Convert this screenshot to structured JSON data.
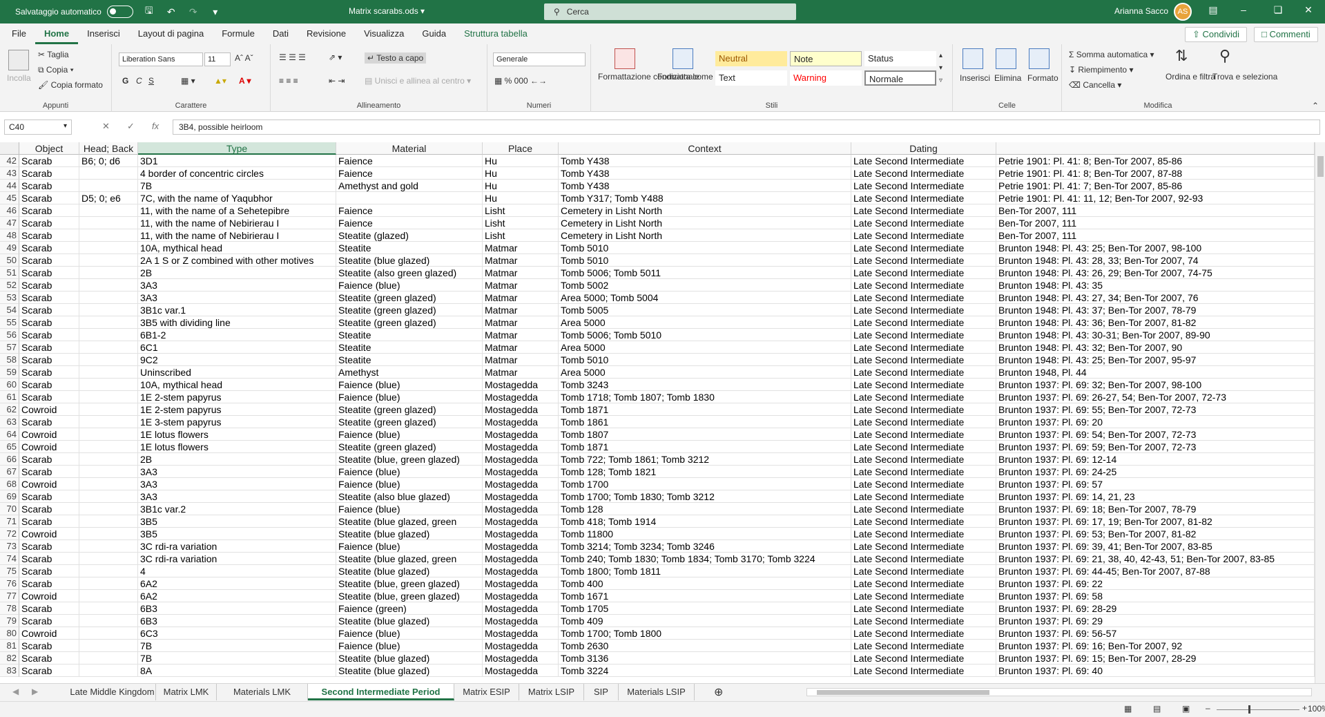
{
  "title_bar": {
    "autosave_label": "Salvataggio automatico",
    "file_name": "Matrix scarabs.ods",
    "search_placeholder": "Cerca",
    "user_name": "Arianna Sacco"
  },
  "menu": {
    "items": [
      "File",
      "Home",
      "Inserisci",
      "Layout di pagina",
      "Formule",
      "Dati",
      "Revisione",
      "Visualizza",
      "Guida",
      "Struttura tabella"
    ],
    "active": "Home",
    "share_label": "Condividi",
    "comments_label": "Commenti"
  },
  "ribbon": {
    "clipboard": {
      "label": "Appunti",
      "paste": "Incolla",
      "cut": "Taglia",
      "copy": "Copia",
      "format_painter": "Copia formato"
    },
    "font": {
      "label": "Carattere",
      "family": "Liberation Sans",
      "size": "11",
      "bold": "G",
      "italic": "C",
      "underline": "S"
    },
    "alignment": {
      "label": "Allineamento",
      "wrap_text": "Testo a capo",
      "merge_center": "Unisci e allinea al centro"
    },
    "number": {
      "label": "Numeri",
      "format": "Generale"
    },
    "styles": {
      "label": "Stili",
      "cond_format": "Formattazione condizionale",
      "format_table": "Formatta come tabella",
      "neutral": "Neutral",
      "note": "Note",
      "status": "Status",
      "text": "Text",
      "warning": "Warning",
      "normal": "Normale"
    },
    "cells": {
      "label": "Celle",
      "insert": "Inserisci",
      "delete": "Elimina",
      "format": "Formato"
    },
    "editing": {
      "label": "Modifica",
      "autosum": "Somma automatica",
      "fill": "Riempimento",
      "clear": "Cancella",
      "sort_filter": "Ordina e filtra",
      "find_select": "Trova e seleziona"
    }
  },
  "formula_bar": {
    "name_box": "C40",
    "formula": "3B4, possible heirloom"
  },
  "columns": [
    "Object",
    "Head; Back",
    "Type",
    "Material",
    "Place",
    "Context",
    "Dating"
  ],
  "rows": [
    [
      "42",
      "Scarab",
      "B6; 0; d6",
      "3D1",
      "Faience",
      "Hu",
      "Tomb Y438",
      "Late Second Intermediate",
      "Petrie 1901: Pl. 41: 8; Ben-Tor 2007, 85-86"
    ],
    [
      "43",
      "Scarab",
      "",
      "4 border of concentric circles",
      "Faience",
      "Hu",
      "Tomb Y438",
      "Late Second Intermediate",
      "Petrie 1901: Pl. 41: 8; Ben-Tor 2007, 87-88"
    ],
    [
      "44",
      "Scarab",
      "",
      "7B",
      "Amethyst and gold",
      "Hu",
      "Tomb Y438",
      "Late Second Intermediate",
      "Petrie 1901: Pl. 41: 7; Ben-Tor 2007, 85-86"
    ],
    [
      "45",
      "Scarab",
      "D5; 0; e6",
      "7C, with the name of Yaqubhor",
      "",
      "Hu",
      "Tomb Y317; Tomb Y488",
      "Late Second Intermediate",
      "Petrie 1901: Pl. 41: 11, 12; Ben-Tor 2007, 92-93"
    ],
    [
      "46",
      "Scarab",
      "",
      "11, with the name of a Sehetepibre",
      "Faience",
      "Lisht",
      "Cemetery in Lisht North",
      "Late Second Intermediate",
      "Ben-Tor 2007, 111"
    ],
    [
      "47",
      "Scarab",
      "",
      "11, with the name of Nebirierau I",
      "Faience",
      "Lisht",
      "Cemetery in Lisht North",
      "Late Second Intermediate",
      "Ben-Tor 2007, 111"
    ],
    [
      "48",
      "Scarab",
      "",
      "11, with the name of Nebirierau I",
      "Steatite (glazed)",
      "Lisht",
      "Cemetery in Lisht North",
      "Late Second Intermediate",
      "Ben-Tor 2007, 111"
    ],
    [
      "49",
      "Scarab",
      "",
      "10A, mythical head",
      "Steatite",
      "Matmar",
      "Tomb 5010",
      "Late Second Intermediate",
      "Brunton 1948: Pl. 43: 25; Ben-Tor 2007, 98-100"
    ],
    [
      "50",
      "Scarab",
      "",
      "2A 1 S or Z combined with other motives",
      "Steatite (blue glazed)",
      "Matmar",
      "Tomb 5010",
      "Late Second Intermediate",
      "Brunton 1948: Pl. 43: 28, 33; Ben-Tor 2007, 74"
    ],
    [
      "51",
      "Scarab",
      "",
      "2B",
      "Steatite (also green glazed)",
      "Matmar",
      "Tomb 5006; Tomb 5011",
      "Late Second Intermediate",
      "Brunton 1948: Pl. 43: 26, 29; Ben-Tor 2007, 74-75"
    ],
    [
      "52",
      "Scarab",
      "",
      "3A3",
      "Faience (blue)",
      "Matmar",
      "Tomb 5002",
      "Late Second Intermediate",
      "Brunton 1948: Pl. 43: 35"
    ],
    [
      "53",
      "Scarab",
      "",
      "3A3",
      "Steatite (green glazed)",
      "Matmar",
      "Area 5000; Tomb 5004",
      "Late Second Intermediate",
      "Brunton 1948: Pl. 43: 27, 34;  Ben-Tor 2007, 76"
    ],
    [
      "54",
      "Scarab",
      "",
      "3B1c var.1",
      "Steatite (green glazed)",
      "Matmar",
      "Tomb 5005",
      "Late Second Intermediate",
      "Brunton 1948: Pl. 43: 37; Ben-Tor 2007, 78-79"
    ],
    [
      "55",
      "Scarab",
      "",
      "3B5 with dividing line",
      "Steatite (green glazed)",
      "Matmar",
      "Area 5000",
      "Late Second Intermediate",
      "Brunton 1948: Pl. 43: 36; Ben-Tor 2007, 81-82"
    ],
    [
      "56",
      "Scarab",
      "",
      "6B1-2",
      "Steatite",
      "Matmar",
      "Tomb 5006; Tomb 5010",
      "Late Second Intermediate",
      "Brunton 1948: Pl. 43: 30-31; Ben-Tor 2007, 89-90"
    ],
    [
      "57",
      "Scarab",
      "",
      "6C1",
      "Steatite",
      "Matmar",
      "Area 5000",
      "Late Second Intermediate",
      "Brunton 1948: Pl. 43: 32; Ben-Tor 2007, 90"
    ],
    [
      "58",
      "Scarab",
      "",
      "9C2",
      "Steatite",
      "Matmar",
      "Tomb 5010",
      "Late Second Intermediate",
      "Brunton 1948: Pl. 43: 25; Ben-Tor 2007, 95-97"
    ],
    [
      "59",
      "Scarab",
      "",
      "Uninscribed",
      "Amethyst",
      "Matmar",
      "Area 5000",
      "Late Second Intermediate",
      "Brunton 1948, Pl. 44"
    ],
    [
      "60",
      "Scarab",
      "",
      "10A, mythical head",
      "Faience (blue)",
      "Mostagedda",
      "Tomb 3243",
      "Late Second Intermediate",
      "Brunton 1937: Pl. 69: 32; Ben-Tor 2007, 98-100"
    ],
    [
      "61",
      "Scarab",
      "",
      "1E 2-stem papyrus",
      "Faience (blue)",
      "Mostagedda",
      "Tomb 1718; Tomb 1807; Tomb 1830",
      "Late Second Intermediate",
      "Brunton 1937: Pl. 69: 26-27, 54; Ben-Tor 2007, 72-73"
    ],
    [
      "62",
      "Cowroid",
      "",
      "1E 2-stem papyrus",
      "Steatite (green glazed)",
      "Mostagedda",
      "Tomb 1871",
      "Late Second Intermediate",
      "Brunton 1937: Pl. 69: 55; Ben-Tor 2007, 72-73"
    ],
    [
      "63",
      "Scarab",
      "",
      "1E 3-stem papyrus",
      "Steatite (green glazed)",
      "Mostagedda",
      "Tomb 1861",
      "Late Second Intermediate",
      "Brunton 1937: Pl. 69: 20"
    ],
    [
      "64",
      "Cowroid",
      "",
      "1E lotus flowers",
      "Faience (blue)",
      "Mostagedda",
      "Tomb 1807",
      "Late Second Intermediate",
      "Brunton 1937: Pl. 69: 54; Ben-Tor 2007, 72-73"
    ],
    [
      "65",
      "Cowroid",
      "",
      "1E lotus flowers",
      "Steatite (green glazed)",
      "Mostagedda",
      "Tomb 1871",
      "Late Second Intermediate",
      "Brunton 1937: Pl. 69: 59; Ben-Tor 2007, 72-73"
    ],
    [
      "66",
      "Scarab",
      "",
      "2B",
      "Steatite (blue, green glazed)",
      "Mostagedda",
      "Tomb 722; Tomb 1861; Tomb 3212",
      "Late Second Intermediate",
      "Brunton 1937: Pl. 69: 12-14"
    ],
    [
      "67",
      "Scarab",
      "",
      "3A3",
      "Faience (blue)",
      "Mostagedda",
      "Tomb 128; Tomb 1821",
      "Late Second Intermediate",
      "Brunton 1937: Pl. 69: 24-25"
    ],
    [
      "68",
      "Cowroid",
      "",
      "3A3",
      "Faience (blue)",
      "Mostagedda",
      "Tomb 1700",
      "Late Second Intermediate",
      "Brunton 1937: Pl. 69: 57"
    ],
    [
      "69",
      "Scarab",
      "",
      "3A3",
      "Steatite (also blue glazed)",
      "Mostagedda",
      "Tomb 1700; Tomb 1830; Tomb 3212",
      "Late Second Intermediate",
      "Brunton 1937: Pl. 69: 14, 21, 23"
    ],
    [
      "70",
      "Scarab",
      "",
      "3B1c var.2",
      "Faience (blue)",
      "Mostagedda",
      "Tomb 128",
      "Late Second Intermediate",
      "Brunton 1937: Pl. 69: 18; Ben-Tor 2007, 78-79"
    ],
    [
      "71",
      "Scarab",
      "",
      "3B5",
      "Steatite (blue glazed, green",
      "Mostagedda",
      "Tomb 418; Tomb 1914",
      "Late Second Intermediate",
      "Brunton 1937: Pl. 69: 17, 19; Ben-Tor 2007, 81-82"
    ],
    [
      "72",
      "Cowroid",
      "",
      "3B5",
      "Steatite (blue glazed)",
      "Mostagedda",
      "Tomb 11800",
      "Late Second Intermediate",
      "Brunton 1937: Pl. 69: 53; Ben-Tor 2007, 81-82"
    ],
    [
      "73",
      "Scarab",
      "",
      "3C rdi-ra variation",
      "Faience (blue)",
      "Mostagedda",
      "Tomb 3214; Tomb 3234; Tomb 3246",
      "Late Second Intermediate",
      "Brunton 1937: Pl. 69: 39, 41; Ben-Tor 2007, 83-85"
    ],
    [
      "74",
      "Scarab",
      "",
      "3C rdi-ra variation",
      "Steatite (blue glazed, green",
      "Mostagedda",
      "Tomb 240; Tomb 1830; Tomb 1834; Tomb 3170; Tomb 3224",
      "Late Second Intermediate",
      "Brunton 1937: Pl. 69: 21, 38, 40, 42-43, 51; Ben-Tor 2007, 83-85"
    ],
    [
      "75",
      "Scarab",
      "",
      "4",
      "Steatite (blue glazed)",
      "Mostagedda",
      "Tomb 1800; Tomb 1811",
      "Late Second Intermediate",
      "Brunton 1937: Pl. 69: 44-45; Ben-Tor 2007, 87-88"
    ],
    [
      "76",
      "Scarab",
      "",
      "6A2",
      "Steatite (blue, green glazed)",
      "Mostagedda",
      "Tomb 400",
      "Late Second Intermediate",
      "Brunton 1937: Pl. 69: 22"
    ],
    [
      "77",
      "Cowroid",
      "",
      "6A2",
      "Steatite (blue, green glazed)",
      "Mostagedda",
      "Tomb 1671",
      "Late Second Intermediate",
      "Brunton 1937: Pl. 69: 58"
    ],
    [
      "78",
      "Scarab",
      "",
      "6B3",
      "Faience (green)",
      "Mostagedda",
      "Tomb 1705",
      "Late Second Intermediate",
      "Brunton 1937: Pl. 69: 28-29"
    ],
    [
      "79",
      "Scarab",
      "",
      "6B3",
      "Steatite (blue glazed)",
      "Mostagedda",
      "Tomb 409",
      "Late Second Intermediate",
      "Brunton 1937: Pl. 69: 29"
    ],
    [
      "80",
      "Cowroid",
      "",
      "6C3",
      "Faience (blue)",
      "Mostagedda",
      "Tomb 1700; Tomb 1800",
      "Late Second Intermediate",
      "Brunton 1937: Pl. 69: 56-57"
    ],
    [
      "81",
      "Scarab",
      "",
      "7B",
      "Faience (blue)",
      "Mostagedda",
      "Tomb 2630",
      "Late Second Intermediate",
      "Brunton 1937: Pl. 69: 16; Ben-Tor 2007, 92"
    ],
    [
      "82",
      "Scarab",
      "",
      "7B",
      "Steatite (blue glazed)",
      "Mostagedda",
      "Tomb 3136",
      "Late Second Intermediate",
      "Brunton 1937: Pl. 69: 15; Ben-Tor 2007, 28-29"
    ],
    [
      "83",
      "Scarab",
      "",
      "8A",
      "Steatite (blue glazed)",
      "Mostagedda",
      "Tomb 3224",
      "Late Second Intermediate",
      "Brunton 1937: Pl. 69: 40"
    ]
  ],
  "sheets": [
    "Late Middle Kingdom",
    "Matrix LMK",
    "Materials LMK",
    "Second Intermediate Period",
    "Matrix ESIP",
    "Matrix LSIP",
    "SIP",
    "Materials LSIP"
  ],
  "active_sheet": "Second Intermediate Period",
  "status": {
    "zoom": "100%"
  },
  "colors": {
    "brand": "#217346"
  }
}
